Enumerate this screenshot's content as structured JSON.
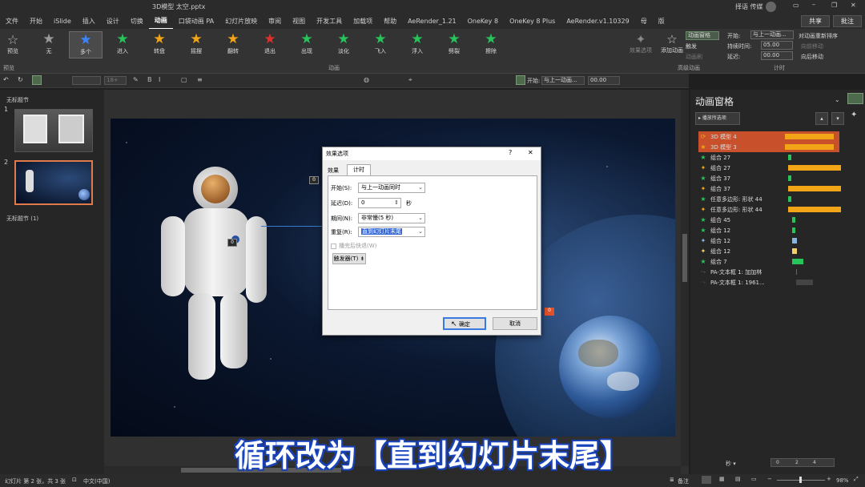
{
  "window": {
    "title": "3D模型 太空.pptx",
    "user": "择语 传媒",
    "share_label": "共享",
    "comment_label": "批注"
  },
  "tabs": [
    "文件",
    "开始",
    "iSlide",
    "插入",
    "设计",
    "切换",
    "动画",
    "口袋动画 PA",
    "幻灯片放映",
    "审阅",
    "视图",
    "开发工具",
    "加载项",
    "帮助",
    "AeRender_1.21",
    "OneKey 8",
    "OneKey 8 Plus",
    "AeRender.v1.10329",
    "母",
    "版"
  ],
  "active_tab": "动画",
  "ribbon": {
    "preview_label": "预览",
    "effects": [
      "无",
      "多个",
      "进入",
      "转盘",
      "摇摆",
      "翻转",
      "退出",
      "出现",
      "淡化",
      "飞入",
      "浮入",
      "劈裂",
      "擦除"
    ],
    "effect_colors": [
      "#9a9a9a",
      "#3a86ff",
      "#27c45a",
      "#f2a516",
      "#f2a516",
      "#f2a516",
      "#e0302b",
      "#27c45a",
      "#27c45a",
      "#27c45a",
      "#27c45a",
      "#27c45a",
      "#27c45a"
    ],
    "effect_options_label": "效果选项",
    "add_animation_label": "添加动画",
    "animation_pane_label": "动画窗格",
    "trigger_label": "触发",
    "animation_painter_label": "动画刷",
    "start_label": "开始:",
    "start_value": "与上一动画...",
    "duration_label": "持续时间:",
    "duration_value": "05.00",
    "delay_label": "延迟:",
    "delay_value": "00.00",
    "reorder_label": "对动画重新排序",
    "move_earlier_label": "向前移动",
    "move_later_label": "向后移动",
    "group_preview": "预览",
    "group_animation": "动画",
    "group_advanced": "高级动画",
    "group_timing": "计时"
  },
  "qat": {
    "start_label": "开始:",
    "start_value": "与上一动画...",
    "delay_value": "00.00",
    "zoom_value": "18+"
  },
  "thumbs": {
    "section1": "无标题节",
    "section2": "无标题节 (1)",
    "slide1_num": "1",
    "slide2_num": "2"
  },
  "dialog": {
    "title": "效果选项",
    "help": "?",
    "close": "✕",
    "tab_effect": "效果",
    "tab_timing": "计时",
    "start_label": "开始(S):",
    "start_value": "与上一动画同时",
    "delay_label": "延迟(D):",
    "delay_value": "0",
    "delay_unit": "秒",
    "period_label": "期间(N):",
    "period_value": "非常慢(5 秒)",
    "repeat_label": "重复(R):",
    "repeat_value": "直到幻灯片末尾",
    "rewind_label": "播完后快退(W)",
    "trigger_label": "触发器(T) ⇟",
    "ok_label": "确定",
    "cancel_label": "取消"
  },
  "pane": {
    "title": "动画窗格",
    "play_label": "播放所选项",
    "index": "0",
    "items": [
      {
        "name": "3D 模型 4",
        "icon": "⟳",
        "color": "#f2a516",
        "start": 0.0,
        "len": 0.85,
        "selected": true
      },
      {
        "name": "3D 模型 3",
        "icon": "★",
        "color": "#f2a516",
        "start": 0.0,
        "len": 0.85,
        "selected": true
      },
      {
        "name": "组合 27",
        "icon": "★",
        "color": "#27c45a",
        "start": 0.05,
        "len": 0.06,
        "selected": false
      },
      {
        "name": "组合 27",
        "icon": "✦",
        "color": "#f2a516",
        "start": 0.05,
        "len": 0.92,
        "selected": false
      },
      {
        "name": "组合 37",
        "icon": "★",
        "color": "#27c45a",
        "start": 0.05,
        "len": 0.06,
        "selected": false
      },
      {
        "name": "组合 37",
        "icon": "✦",
        "color": "#f2a516",
        "start": 0.05,
        "len": 0.92,
        "selected": false
      },
      {
        "name": "任意多边形: 形状 44",
        "icon": "★",
        "color": "#27c45a",
        "start": 0.05,
        "len": 0.06,
        "selected": false
      },
      {
        "name": "任意多边形: 形状 44",
        "icon": "✦",
        "color": "#f2a516",
        "start": 0.05,
        "len": 0.92,
        "selected": false
      },
      {
        "name": "组合 45",
        "icon": "★",
        "color": "#27c45a",
        "start": 0.12,
        "len": 0.06,
        "selected": false
      },
      {
        "name": "组合 12",
        "icon": "★",
        "color": "#27c45a",
        "start": 0.12,
        "len": 0.06,
        "selected": false
      },
      {
        "name": "组合 12",
        "icon": "✦",
        "color": "#8ab4e0",
        "start": 0.12,
        "len": 0.09,
        "selected": false
      },
      {
        "name": "组合 12",
        "icon": "✦",
        "color": "#f2d06e",
        "start": 0.12,
        "len": 0.09,
        "selected": false
      },
      {
        "name": "组合 7",
        "icon": "★",
        "color": "#27c45a",
        "start": 0.12,
        "len": 0.2,
        "selected": false
      },
      {
        "name": "PA-文本框 1: 加加林",
        "icon": "⤳",
        "color": "#555555",
        "start": 0.2,
        "len": 0.0,
        "selected": false
      },
      {
        "name": "PA-文本框 1: 1961...",
        "icon": "⤳",
        "color": "#444444",
        "start": 0.2,
        "len": 0.28,
        "selected": false
      }
    ],
    "seconds_label": "秒 ▾",
    "timeline": [
      "0",
      "2",
      "4"
    ]
  },
  "slide_markers": {
    "astronaut": "0",
    "earth": "0",
    "tag": "0"
  },
  "status": {
    "left": "幻灯片 第 2 张，共 3 张",
    "lang": "中文(中国)",
    "notes": "备注",
    "zoom": "98%"
  },
  "caption": "循环改为【直到幻灯片末尾】"
}
